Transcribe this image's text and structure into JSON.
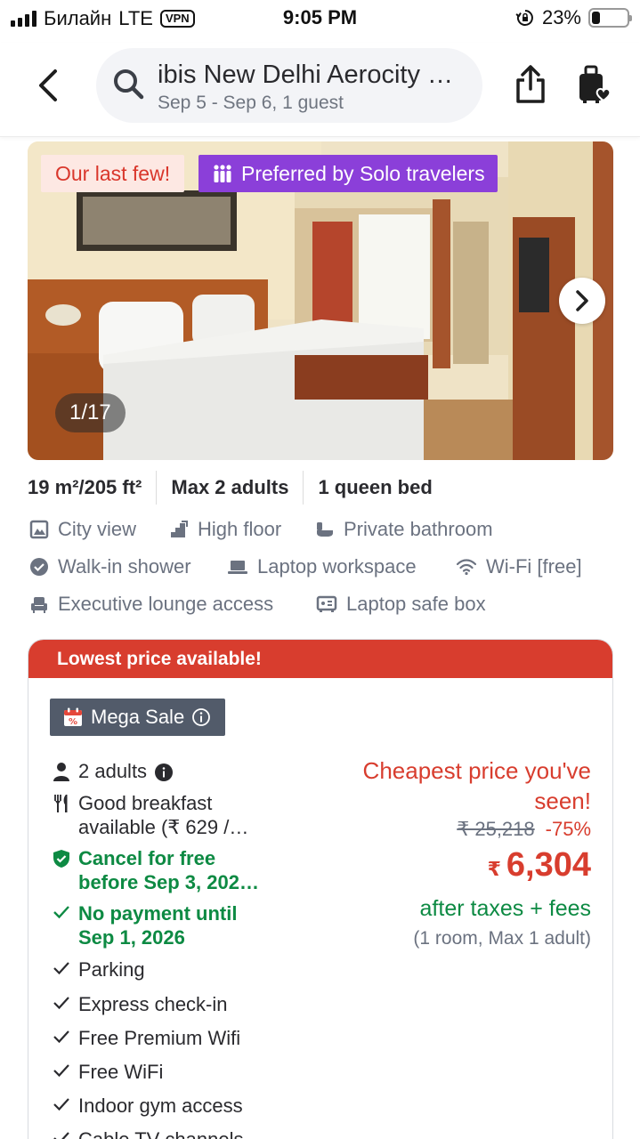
{
  "status_bar": {
    "carrier": "Билайн",
    "network": "LTE",
    "vpn": "VPN",
    "time": "9:05 PM",
    "battery": "23%"
  },
  "header": {
    "search_title": "ibis New Delhi Aerocity Hotel",
    "search_subtitle": "Sep 5 - Sep 6, 1 guest"
  },
  "photo": {
    "badge_scarcity": "Our last few!",
    "badge_preferred": "Preferred by Solo travelers",
    "counter": "1/17"
  },
  "specs": {
    "size": "19 m²/205 ft²",
    "occupancy": "Max 2 adults",
    "bed": "1 queen bed"
  },
  "amenities": [
    {
      "label": "City view",
      "icon": "city-view-icon"
    },
    {
      "label": "High floor",
      "icon": "high-floor-icon"
    },
    {
      "label": "Private bathroom",
      "icon": "bathroom-icon"
    },
    {
      "label": "Walk-in shower",
      "icon": "check-circle-icon"
    },
    {
      "label": "Laptop workspace",
      "icon": "laptop-icon"
    },
    {
      "label": "Wi-Fi [free]",
      "icon": "wifi-icon"
    },
    {
      "label": "Executive lounge access",
      "icon": "lounge-icon"
    },
    {
      "label": "Laptop safe box",
      "icon": "safe-box-icon"
    }
  ],
  "offer": {
    "header": "Lowest price available!",
    "promo_label": "Mega Sale",
    "features": {
      "adults": "2 adults",
      "breakfast_line1": "Good breakfast",
      "breakfast_line2": "available (₹ 629 /…",
      "cancel_line1": "Cancel for free",
      "cancel_line2": "before Sep 3, 202…",
      "payment_line1": "No payment until",
      "payment_line2": "Sep 1, 2026",
      "list": [
        "Parking",
        "Express check-in",
        "Free Premium Wifi",
        "Free WiFi",
        "Indoor gym access",
        "Cable TV channels"
      ]
    },
    "price": {
      "cheapest_note": "Cheapest price you've seen!",
      "original": "₹ 25,218",
      "discount": "-75%",
      "currency": "₹",
      "current": "6,304",
      "taxes_note": "after taxes + fees",
      "rooms_note": "(1 room, Max 1 adult)"
    }
  },
  "colors": {
    "sale_red": "#d83d2e",
    "solo_purple": "#8b3fd9",
    "green": "#0d8a43",
    "promo_slate": "#525b6a"
  }
}
